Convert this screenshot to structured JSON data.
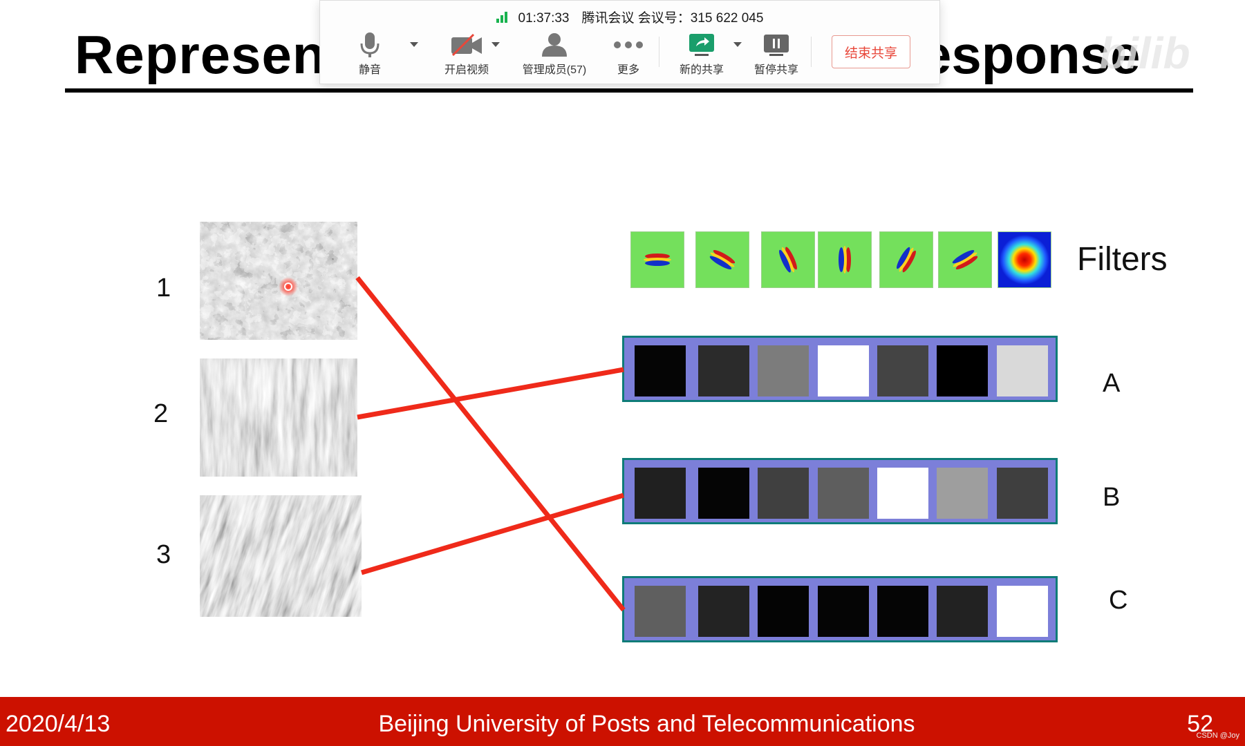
{
  "slide": {
    "title_left": "Represent",
    "title_right": "esponse",
    "watermark": "bilib",
    "filters_label": "Filters",
    "image_numbers": [
      "1",
      "2",
      "3"
    ],
    "vector_labels": [
      "A",
      "B",
      "C"
    ],
    "vectors": [
      {
        "label": "A",
        "cells": [
          "#050505",
          "#2b2b2b",
          "#7c7c7c",
          "#ffffff",
          "#444444",
          "#000000",
          "#d9d9d9"
        ]
      },
      {
        "label": "B",
        "cells": [
          "#202020",
          "#050505",
          "#404040",
          "#5e5e5e",
          "#ffffff",
          "#9e9e9e",
          "#3f3f3f"
        ]
      },
      {
        "label": "C",
        "cells": [
          "#5f5f5f",
          "#232323",
          "#040404",
          "#050505",
          "#050505",
          "#222222",
          "#ffffff"
        ]
      }
    ],
    "filter_angles": [
      0,
      30,
      65,
      90,
      120,
      150
    ],
    "filter_icons": [
      "gabor-filter-0",
      "gabor-filter-30",
      "gabor-filter-65",
      "gabor-filter-90",
      "gabor-filter-120",
      "gabor-filter-150",
      "gaussian-blob"
    ],
    "matches": [
      {
        "image": "1",
        "vector": "C"
      },
      {
        "image": "2",
        "vector": "A"
      },
      {
        "image": "3",
        "vector": "B"
      }
    ],
    "accent_color": "#ef2a1a"
  },
  "meeting": {
    "time": "01:37:33",
    "meeting_info": "腾讯会议 会议号：315 622 045",
    "buttons": {
      "mute": "静音",
      "video": "开启视频",
      "members": "管理成员(57)",
      "more": "更多",
      "new_share": "新的共享",
      "pause_share": "暂停共享"
    },
    "end_share": "结束共享"
  },
  "footer": {
    "date": "2020/4/13",
    "institution": "Beijing University of Posts and Telecommunications",
    "page": "52",
    "credit": "CSDN @Joy"
  },
  "colors": {
    "footer_bg": "#cc1100",
    "vector_bg": "#7c7fd9",
    "vector_border": "#0e7c78",
    "filter_bg": "#74e05c"
  }
}
